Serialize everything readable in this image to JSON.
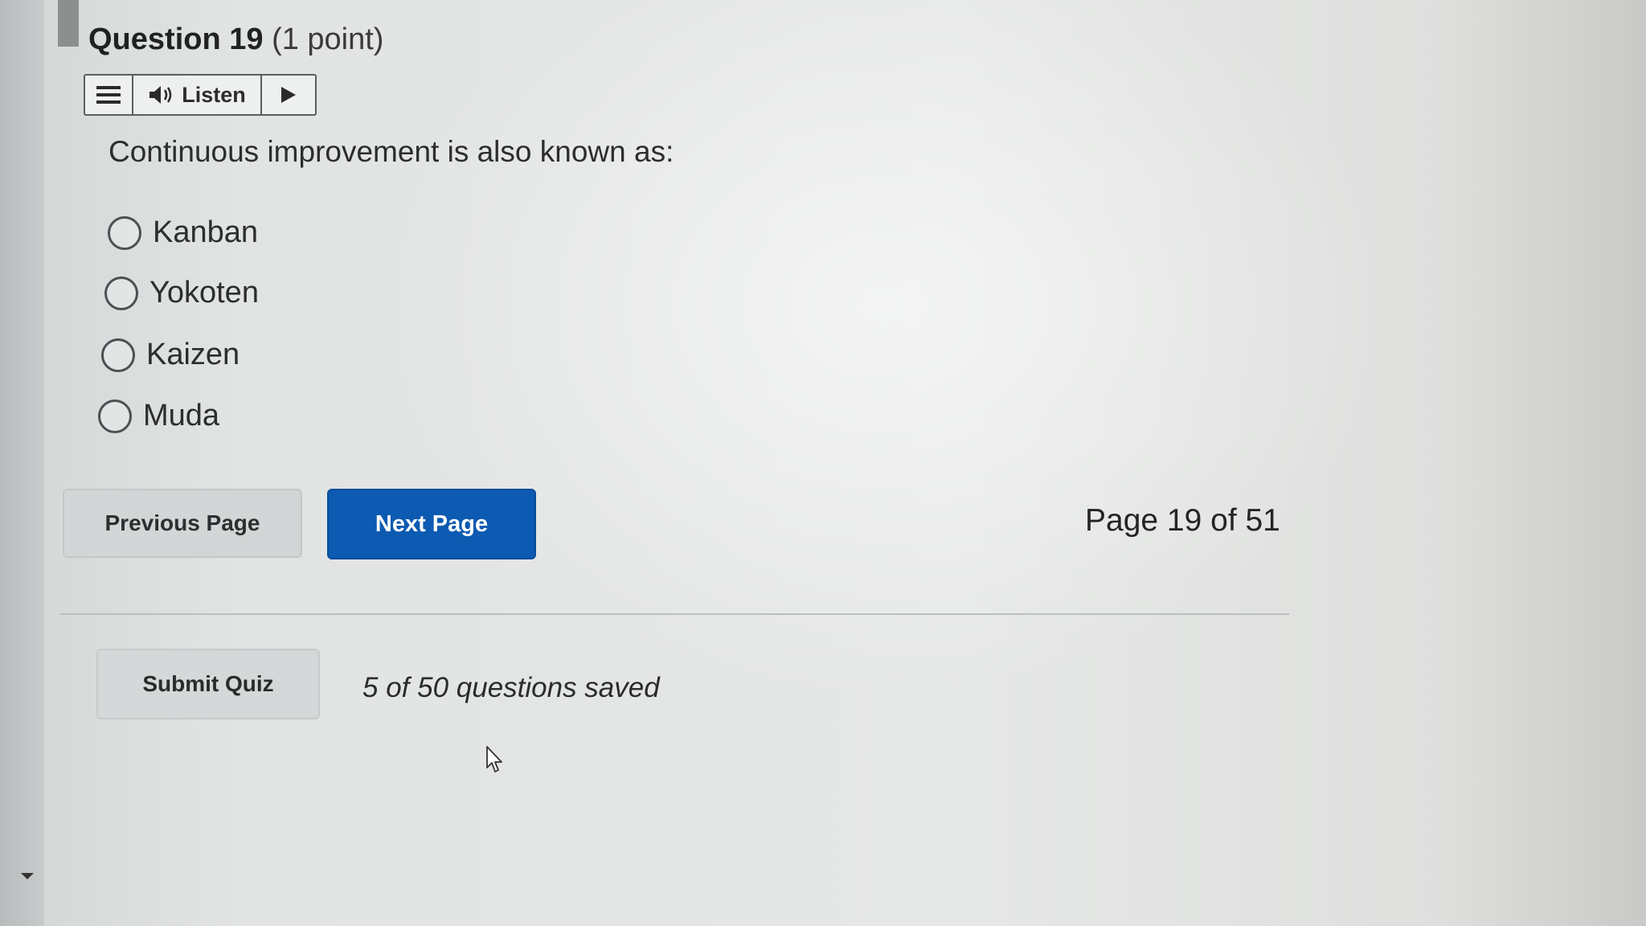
{
  "question": {
    "number_label": "Question 19",
    "points_label": "(1 point)",
    "prompt": "Continuous improvement is also known as:"
  },
  "listen_toolbar": {
    "menu_icon": "hamburger-menu-icon",
    "speaker_icon": "speaker-icon",
    "listen_label": "Listen",
    "play_icon": "play-icon"
  },
  "options": [
    {
      "label": "Kanban",
      "selected": false
    },
    {
      "label": "Yokoten",
      "selected": false
    },
    {
      "label": "Kaizen",
      "selected": false
    },
    {
      "label": "Muda",
      "selected": false
    }
  ],
  "navigation": {
    "previous_label": "Previous Page",
    "next_label": "Next Page",
    "page_indicator": "Page 19 of 51"
  },
  "footer": {
    "submit_label": "Submit Quiz",
    "saved_status": "5 of 50 questions saved"
  },
  "colors": {
    "primary_button": "#0c5ab2",
    "secondary_button": "#d2d6d6",
    "text": "#2c2d2e"
  }
}
